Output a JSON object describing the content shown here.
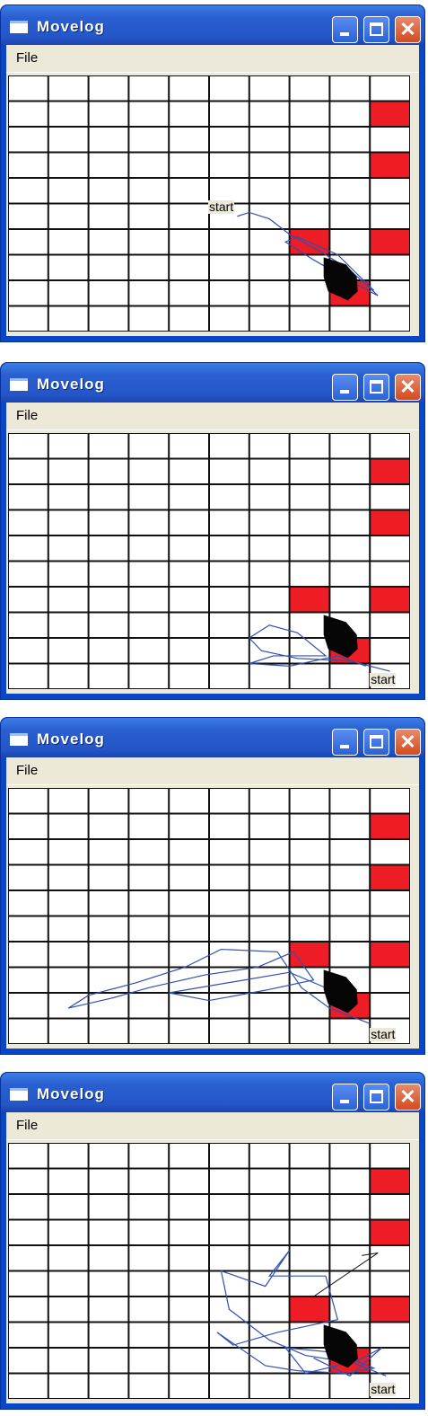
{
  "window_title": "Movelog",
  "menu": {
    "file": "File"
  },
  "grid": {
    "columns": 10,
    "rows": 10,
    "red_cells": [
      [
        9,
        1
      ],
      [
        9,
        3
      ],
      [
        7,
        6
      ],
      [
        9,
        6
      ],
      [
        8,
        8
      ]
    ]
  },
  "colors": {
    "red": "#ee1c24",
    "trajectory": "#3050b0",
    "grid_line": "#111111"
  },
  "panels": [
    {
      "start_label": "start",
      "start_cell": [
        5,
        5
      ]
    },
    {
      "start_label": "start",
      "start_cell": [
        9,
        9
      ]
    },
    {
      "start_label": "start",
      "start_cell": [
        9,
        9
      ]
    },
    {
      "start_label": "start",
      "start_cell": [
        9,
        9
      ]
    }
  ]
}
